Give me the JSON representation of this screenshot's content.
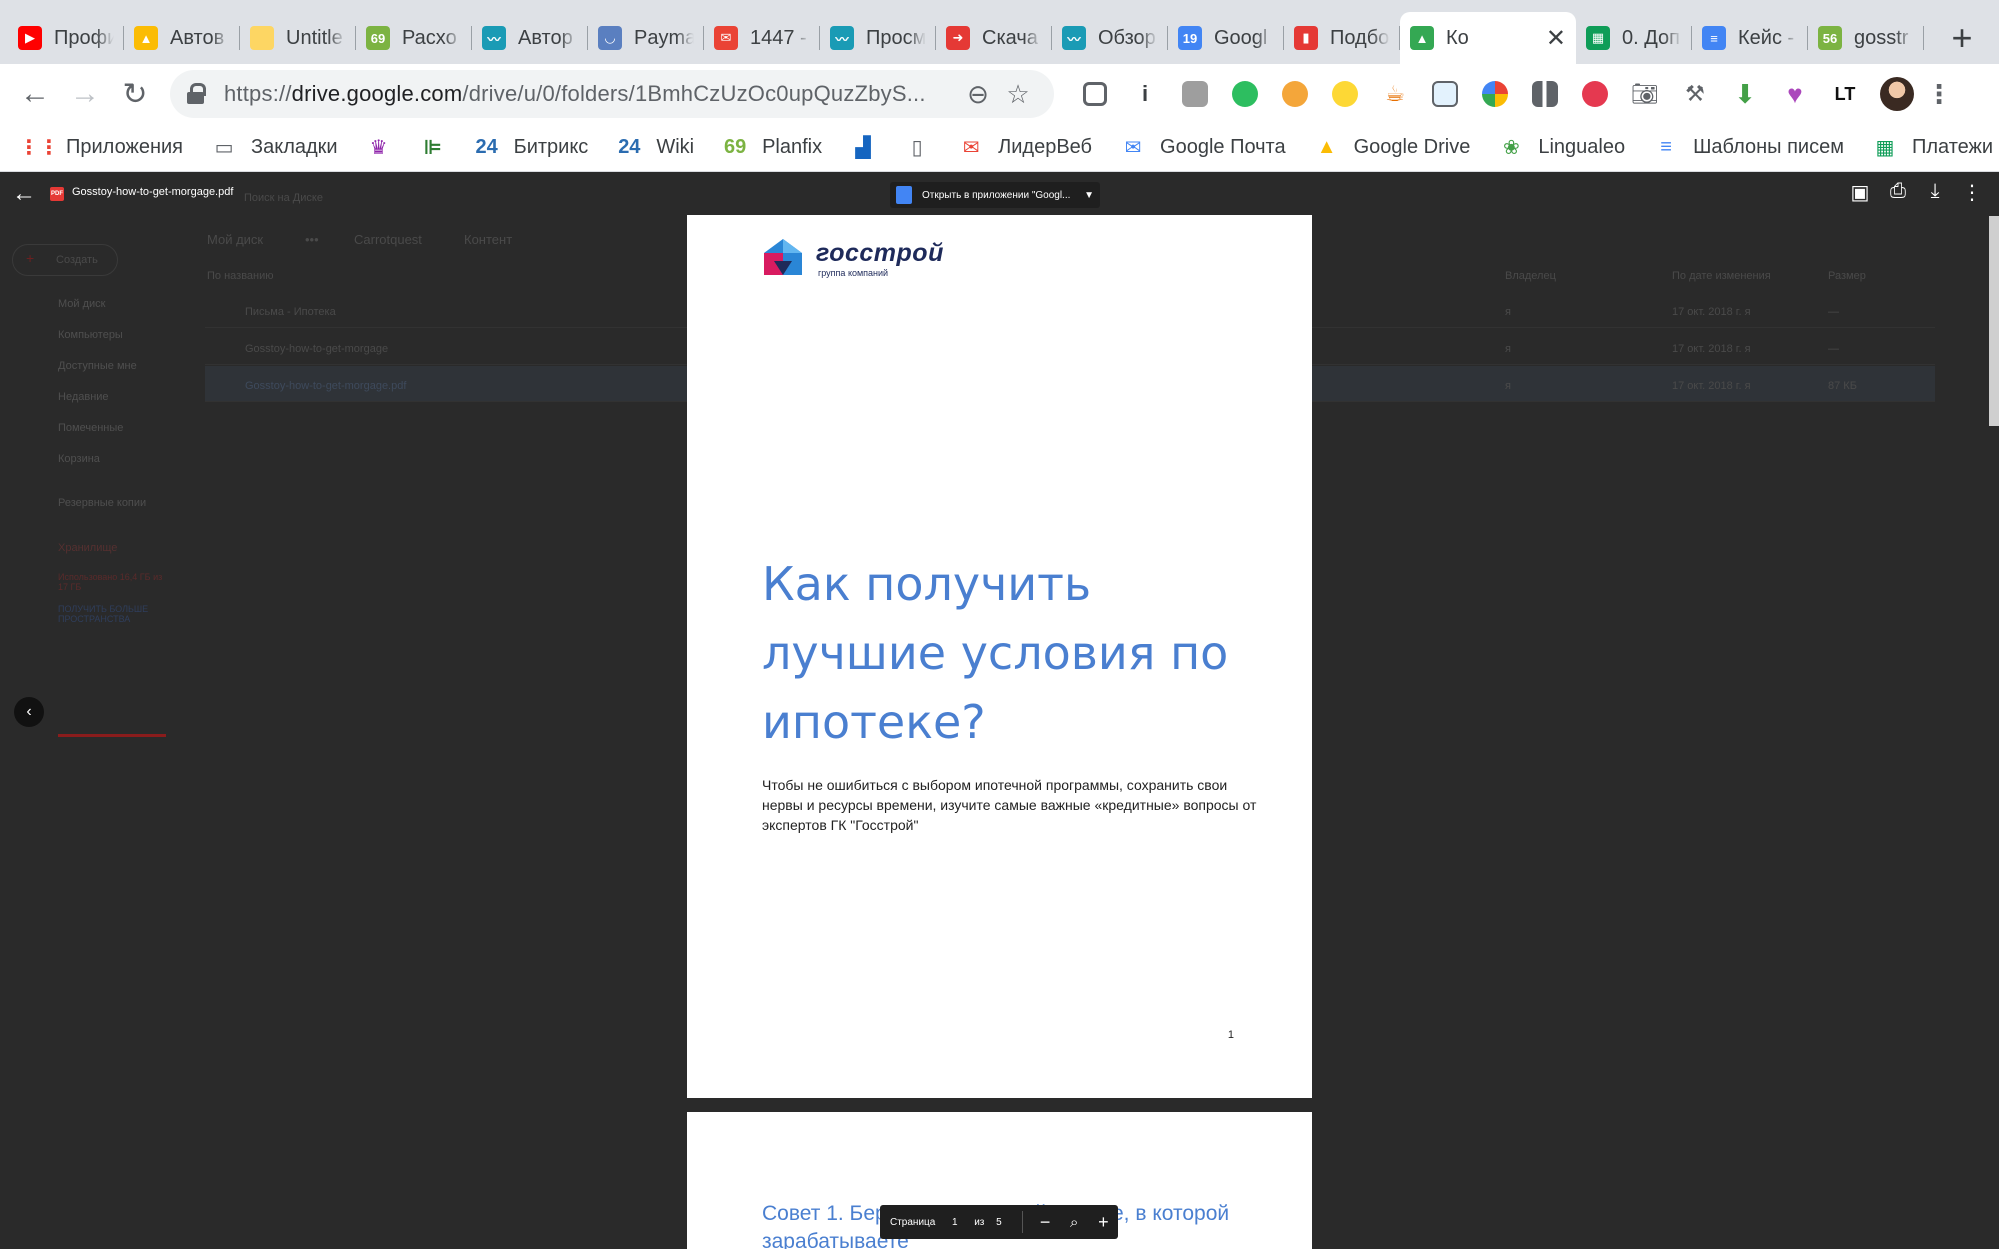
{
  "browser": {
    "tabs": [
      {
        "title": "Профи",
        "favicon": "youtube-icon",
        "color": "#ff0000",
        "glyph": "▶"
      },
      {
        "title": "Автов",
        "favicon": "google-drive-icon",
        "color": "#fbbc04",
        "glyph": "▲"
      },
      {
        "title": "Untitle",
        "favicon": "sticky-note-icon",
        "color": "#fdd663",
        "glyph": ""
      },
      {
        "title": "Расхо",
        "favicon": "planfix-icon",
        "color": "#7cb342",
        "glyph": "69"
      },
      {
        "title": "Автор",
        "favicon": "analytics-icon",
        "color": "#1a9bb5",
        "glyph": "〰"
      },
      {
        "title": "Payma",
        "favicon": "paymaster-icon",
        "color": "#5a7fc0",
        "glyph": "◡"
      },
      {
        "title": "1447 -",
        "favicon": "gmail-icon",
        "color": "#ea4335",
        "glyph": "✉"
      },
      {
        "title": "Просм",
        "favicon": "analytics-icon",
        "color": "#1a9bb5",
        "glyph": "〰"
      },
      {
        "title": "Скача",
        "favicon": "arrow-icon",
        "color": "#e53935",
        "glyph": "➜"
      },
      {
        "title": "Обзор",
        "favicon": "analytics-icon",
        "color": "#1a9bb5",
        "glyph": "〰"
      },
      {
        "title": "Googl",
        "favicon": "calendar-icon",
        "color": "#4285f4",
        "glyph": "19"
      },
      {
        "title": "Подбо",
        "favicon": "chart-icon",
        "color": "#e53935",
        "glyph": "▮"
      },
      {
        "title": "Ко",
        "favicon": "google-drive-icon",
        "color": "#34a853",
        "glyph": "▲",
        "active": true
      },
      {
        "title": "0. Доп",
        "favicon": "sheets-icon",
        "color": "#0f9d58",
        "glyph": "▦"
      },
      {
        "title": "Кейс -",
        "favicon": "docs-icon",
        "color": "#4285f4",
        "glyph": "≡"
      },
      {
        "title": "gosstr",
        "favicon": "planfix-icon",
        "color": "#7cb342",
        "glyph": "56"
      }
    ],
    "url_scheme": "https://",
    "url_host": "drive.google.com",
    "url_path": "/drive/u/0/folders/1BmhCzUzOc0upQuzZbyS...",
    "bookmarks": [
      {
        "label": "Приложения",
        "icon": "apps-grid-icon",
        "color": "#ea4335",
        "glyph": "⋮⋮"
      },
      {
        "label": "Закладки",
        "icon": "folder-icon",
        "color": "#5f6368",
        "glyph": "▭"
      },
      {
        "label": "",
        "icon": "crown-icon",
        "color": "#8e24aa",
        "glyph": "♛"
      },
      {
        "label": "",
        "icon": "ladder-icon",
        "color": "#2e7d32",
        "glyph": "⊫"
      },
      {
        "label": "Битрикс",
        "icon": "bitrix-icon",
        "color": "#2b6cb0",
        "glyph": "24"
      },
      {
        "label": "Wiki",
        "icon": "bitrix-icon",
        "color": "#2b6cb0",
        "glyph": "24"
      },
      {
        "label": "Planfix",
        "icon": "planfix-icon",
        "color": "#7cb342",
        "glyph": "69"
      },
      {
        "label": "",
        "icon": "bars-icon",
        "color": "#1565c0",
        "glyph": "▟"
      },
      {
        "label": "",
        "icon": "page-icon",
        "color": "#5f6368",
        "glyph": "▯"
      },
      {
        "label": "ЛидерВеб",
        "icon": "gmail-icon",
        "color": "#ea4335",
        "glyph": "✉"
      },
      {
        "label": "Google Почта",
        "icon": "inbox-icon",
        "color": "#4285f4",
        "glyph": "✉"
      },
      {
        "label": "Google Drive",
        "icon": "google-drive-icon",
        "color": "#fbbc04",
        "glyph": "▲"
      },
      {
        "label": "Lingualeo",
        "icon": "lingualeo-icon",
        "color": "#43a047",
        "glyph": "❀"
      },
      {
        "label": "Шаблоны писем",
        "icon": "docs-icon",
        "color": "#4285f4",
        "glyph": "≡"
      },
      {
        "label": "Платежи",
        "icon": "sheets-icon",
        "color": "#0f9d58",
        "glyph": "▦"
      }
    ]
  },
  "viewer": {
    "file_name": "Gosstoy-how-to-get-morgage.pdf",
    "pdf_badge": "PDF",
    "open_with": "Открыть в приложении \"Googl...",
    "page_label": "Страница",
    "page_current": "1",
    "page_of": "из",
    "page_total": "5"
  },
  "drive_background": {
    "search": "Поиск на Диске",
    "breadcrumb": [
      "Мой диск",
      "•••",
      "Carrotquest",
      "Контент"
    ],
    "create": "Создать",
    "column_name": "По названию",
    "column_owner": "Владелец",
    "column_modified": "По дате изменения",
    "column_size": "Размер",
    "sidebar": [
      "Мой диск",
      "Компьютеры",
      "Доступные мне",
      "Недавние",
      "Помеченные",
      "Корзина",
      "Резервные копии",
      "Хранилище"
    ],
    "storage_used": "Использовано 16,4 ГБ из 17 ГБ",
    "storage_upgrade": "ПОЛУЧИТЬ БОЛЬШЕ ПРОСТРАНСТВА",
    "files": [
      {
        "name": "Письма - Ипотека",
        "owner": "я",
        "modified": "17 окт. 2018 г. я",
        "size": "—"
      },
      {
        "name": "Gosstoy-how-to-get-morgage",
        "owner": "я",
        "modified": "17 окт. 2018 г. я",
        "size": "—"
      },
      {
        "name": "Gosstoy-how-to-get-morgage.pdf",
        "owner": "я",
        "modified": "17 окт. 2018 г. я",
        "size": "87 КБ"
      }
    ]
  },
  "document": {
    "logo_name": "госстрой",
    "logo_sub": "группа компаний",
    "title": "Как получить лучшие условия по ипотеке?",
    "subtitle": "Чтобы не ошибиться с выбором ипотечной программы, сохранить свои нервы и ресурсы времени, изучите самые важные «кредитные» вопросы от экспертов ГК \"Госстрой\"",
    "page_number": "1",
    "advice_1": "Совет 1. Берите кредит в той валюте, в которой зарабатываете"
  },
  "colors": {
    "accent_blue": "#4a7fd0",
    "logo_navy": "#1e2a5a"
  }
}
